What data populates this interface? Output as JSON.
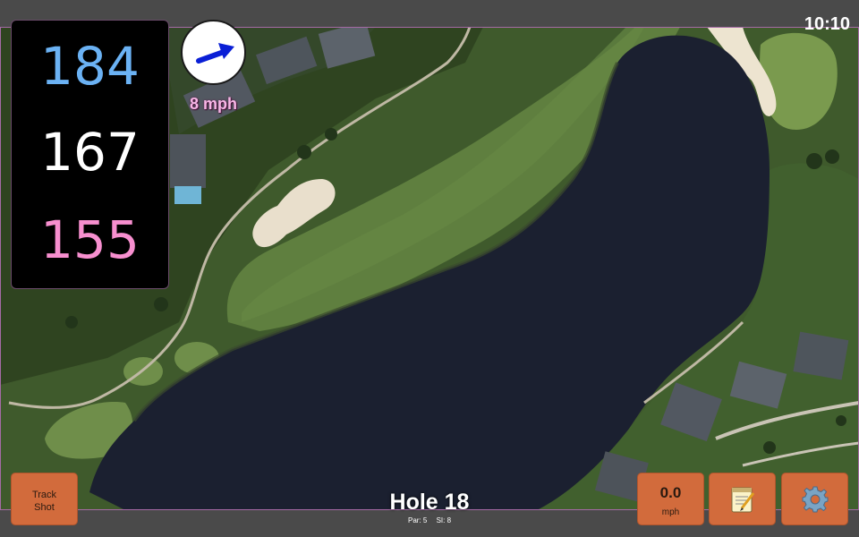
{
  "status": {
    "time": "10:10"
  },
  "distances": {
    "back": "184",
    "middle": "167",
    "front": "155"
  },
  "wind": {
    "speed": "8 mph",
    "icon": "wind-arrow-icon"
  },
  "hole": {
    "title": "Hole 18",
    "par": "Par: 5",
    "si": "SI: 8"
  },
  "buttons": {
    "track_shot": "Track\nShot",
    "speed_value": "0.0",
    "speed_unit": "mph",
    "notes_icon": "notepad-icon",
    "settings_icon": "gear-icon"
  },
  "colors": {
    "back": "#6bb2f4",
    "middle": "#ffffff",
    "front": "#f78fcf",
    "button": "#d26b3c",
    "water": "#1b2030"
  }
}
